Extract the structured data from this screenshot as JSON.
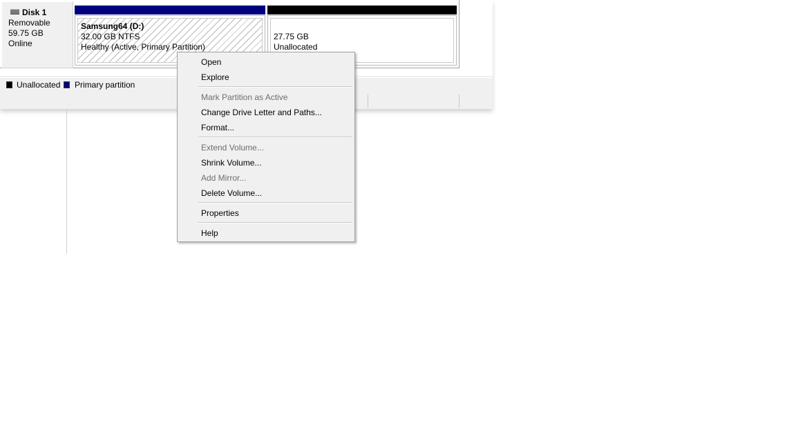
{
  "disk": {
    "name": "Disk 1",
    "type": "Removable",
    "size": "59.75 GB",
    "status": "Online"
  },
  "partitions": [
    {
      "name": "Samsung64  (D:)",
      "size_fs": "32.00 GB NTFS",
      "status": "Healthy (Active, Primary Partition)",
      "color": "#00007f"
    },
    {
      "size": "27.75 GB",
      "status": "Unallocated",
      "color": "#000000"
    }
  ],
  "legend": [
    {
      "label": "Unallocated",
      "color": "#000000"
    },
    {
      "label": "Primary partition",
      "color": "#00007f"
    }
  ],
  "context_menu": {
    "open": "Open",
    "explore": "Explore",
    "mark_active": "Mark Partition as Active",
    "change_letter": "Change Drive Letter and Paths...",
    "format": "Format...",
    "extend": "Extend Volume...",
    "shrink": "Shrink Volume...",
    "add_mirror": "Add Mirror...",
    "delete": "Delete Volume...",
    "properties": "Properties",
    "help": "Help"
  }
}
